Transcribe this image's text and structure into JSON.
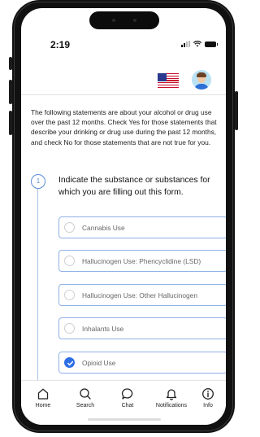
{
  "status": {
    "time": "2:19"
  },
  "intro_text": "The following statements are about your alcohol or drug use over the past 12 months. Check Yes for those statements that describe your drinking or drug use during the past 12 months, and check No for those statements that are not true for you.",
  "question": {
    "number": "1",
    "text": "Indicate the substance or substances for which you are filling out this form."
  },
  "options": [
    {
      "label": "Cannabis Use",
      "checked": false
    },
    {
      "label": "Hallucinogen Use: Phencyclidine (LSD)",
      "checked": false
    },
    {
      "label": "Hallucinogen Use: Other Hallucinogen",
      "checked": false
    },
    {
      "label": "Inhalants Use",
      "checked": false
    },
    {
      "label": "Opioid Use",
      "checked": true
    }
  ],
  "tabbar": {
    "home": "Home",
    "search": "Search",
    "chat": "Chat",
    "notifications": "Notifications",
    "info": "Info"
  },
  "colors": {
    "accent": "#2f6fe4",
    "option_border": "#8fb1e6"
  }
}
